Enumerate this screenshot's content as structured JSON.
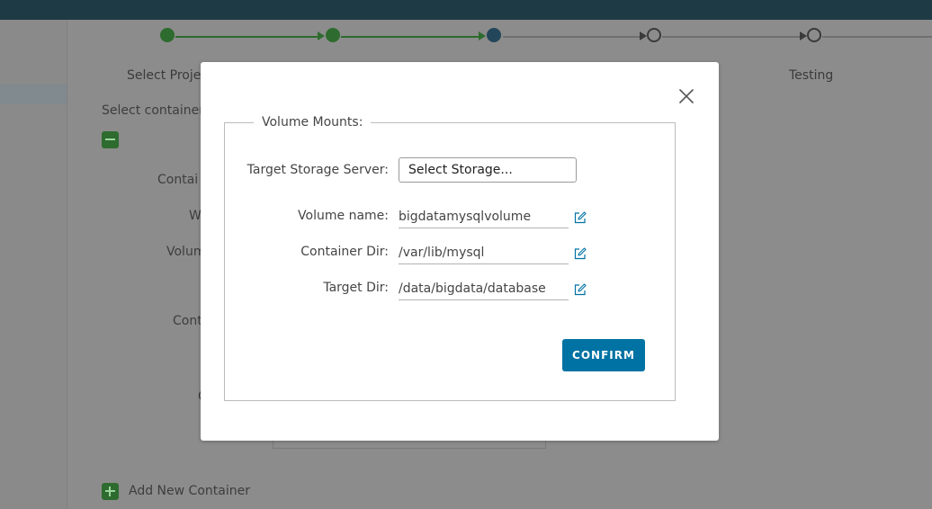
{
  "background": {
    "steps": [
      {
        "label": "Select Proje",
        "state": "done"
      },
      {
        "label": "",
        "state": "done"
      },
      {
        "label": "",
        "state": "current"
      },
      {
        "label": "",
        "state": "todo"
      },
      {
        "label": "Testing",
        "state": "todo"
      }
    ],
    "select_container_text": "Select container",
    "form_labels": [
      "Contai",
      "W",
      "Volum",
      "Cont",
      "C"
    ],
    "add_new_container": "Add New Container"
  },
  "modal": {
    "legend": "Volume Mounts:",
    "target_storage_label": "Target Storage Server:",
    "target_storage_value": "Select Storage...",
    "volume_name_label": "Volume name:",
    "volume_name_value": "bigdatamysqlvolume",
    "container_dir_label": "Container Dir:",
    "container_dir_value": "/var/lib/mysql",
    "target_dir_label": "Target Dir:",
    "target_dir_value": "/data/bigdata/database",
    "confirm_label": "CONFIRM"
  },
  "colors": {
    "accent": "#0072a3",
    "step_done": "#2e6b2e",
    "step_current": "#24465a",
    "header": "#1e3a45"
  }
}
